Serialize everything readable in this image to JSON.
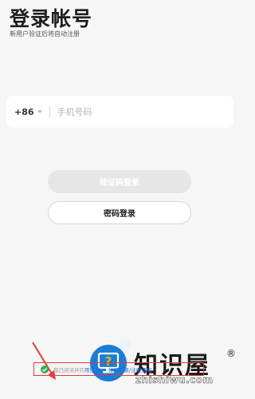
{
  "header": {
    "title": "登录帐号",
    "subtitle": "新用户验证后将自动注册"
  },
  "phone": {
    "country_code": "+86",
    "placeholder": "手机号码"
  },
  "buttons": {
    "code_login": "验证码登录",
    "password_login": "密码登录"
  },
  "agreement": {
    "prefix": "我已阅读并同",
    "link1": "用协议",
    "separator": "、",
    "link2": "帐号登录/注册须知"
  },
  "watermark": {
    "brand": "知识屋",
    "registered": "®",
    "url": "zhishiwu.com",
    "icon": "question-monitor-icon"
  },
  "colors": {
    "accent_link": "#2a6fd1",
    "check_green": "#2fb34a",
    "highlight_red": "#e53a3a",
    "watermark_blue": "#1b7dd6"
  }
}
